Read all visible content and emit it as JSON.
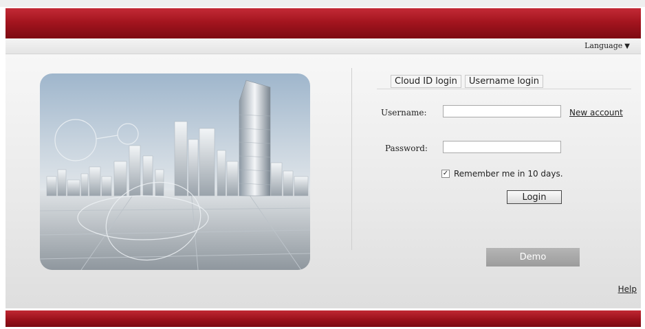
{
  "header": {
    "language_label": "Language",
    "language_arrow": "▼"
  },
  "login": {
    "tabs": [
      {
        "label": "Cloud ID login"
      },
      {
        "label": "Username login"
      }
    ],
    "username_label": "Username:",
    "username_value": "",
    "password_label": "Password:",
    "password_value": "",
    "new_account_link": "New account",
    "remember_checked": true,
    "remember_mark": "✓",
    "remember_label": "Remember me in 10 days.",
    "login_button": "Login",
    "demo_button": "Demo"
  },
  "footer": {
    "help_link": "Help"
  },
  "colors": {
    "brand_red": "#a4151f",
    "dark_red": "#7d0a12",
    "demo_gray": "#a8a8a8"
  },
  "icons": {
    "language_dropdown": "triangle-down-icon",
    "checkbox": "checkmark-icon"
  }
}
